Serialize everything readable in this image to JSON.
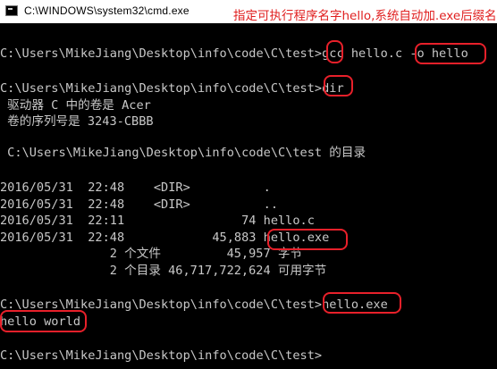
{
  "window": {
    "title": "C:\\WINDOWS\\system32\\cmd.exe",
    "icon": "cmd-icon"
  },
  "annotation": {
    "note": "指定可执行程序名字hello,系统自动加.exe后缀名",
    "color": "#e02020"
  },
  "colors": {
    "background": "#000000",
    "text": "#c8c8c8",
    "highlight": "#e8202a"
  },
  "console": {
    "lines": [
      "C:\\Users\\MikeJiang\\Desktop\\info\\code\\C\\test>gcc hello.c -o hello",
      "C:\\Users\\MikeJiang\\Desktop\\info\\code\\C\\test>dir",
      " 驱动器 C 中的卷是 Acer",
      " 卷的序列号是 3243-CBBB",
      " C:\\Users\\MikeJiang\\Desktop\\info\\code\\C\\test 的目录",
      "2016/05/31  22:48    <DIR>          .",
      "2016/05/31  22:48    <DIR>          ..",
      "2016/05/31  22:11                74 hello.c",
      "2016/05/31  22:48            45,883 hello.exe",
      "               2 个文件         45,957 字节",
      "               2 个目录 46,717,722,624 可用字节",
      "C:\\Users\\MikeJiang\\Desktop\\info\\code\\C\\test>hello.exe",
      "hello world",
      "C:\\Users\\MikeJiang\\Desktop\\info\\code\\C\\test>"
    ]
  }
}
